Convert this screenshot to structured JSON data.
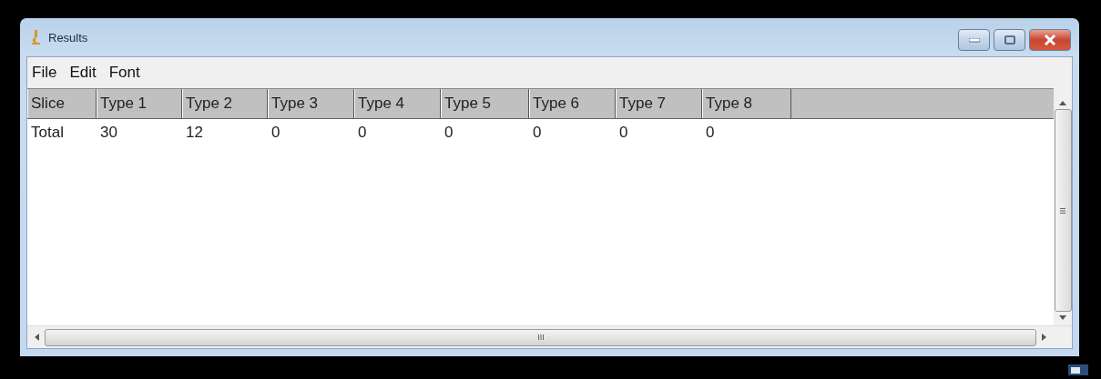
{
  "window": {
    "title": "Results"
  },
  "menu": [
    "File",
    "Edit",
    "Font"
  ],
  "table": {
    "columns": [
      "Slice",
      "Type 1",
      "Type 2",
      "Type 3",
      "Type 4",
      "Type 5",
      "Type 6",
      "Type 7",
      "Type 8"
    ],
    "rows": [
      [
        "Total",
        "30",
        "12",
        "0",
        "0",
        "0",
        "0",
        "0",
        "0"
      ]
    ]
  }
}
